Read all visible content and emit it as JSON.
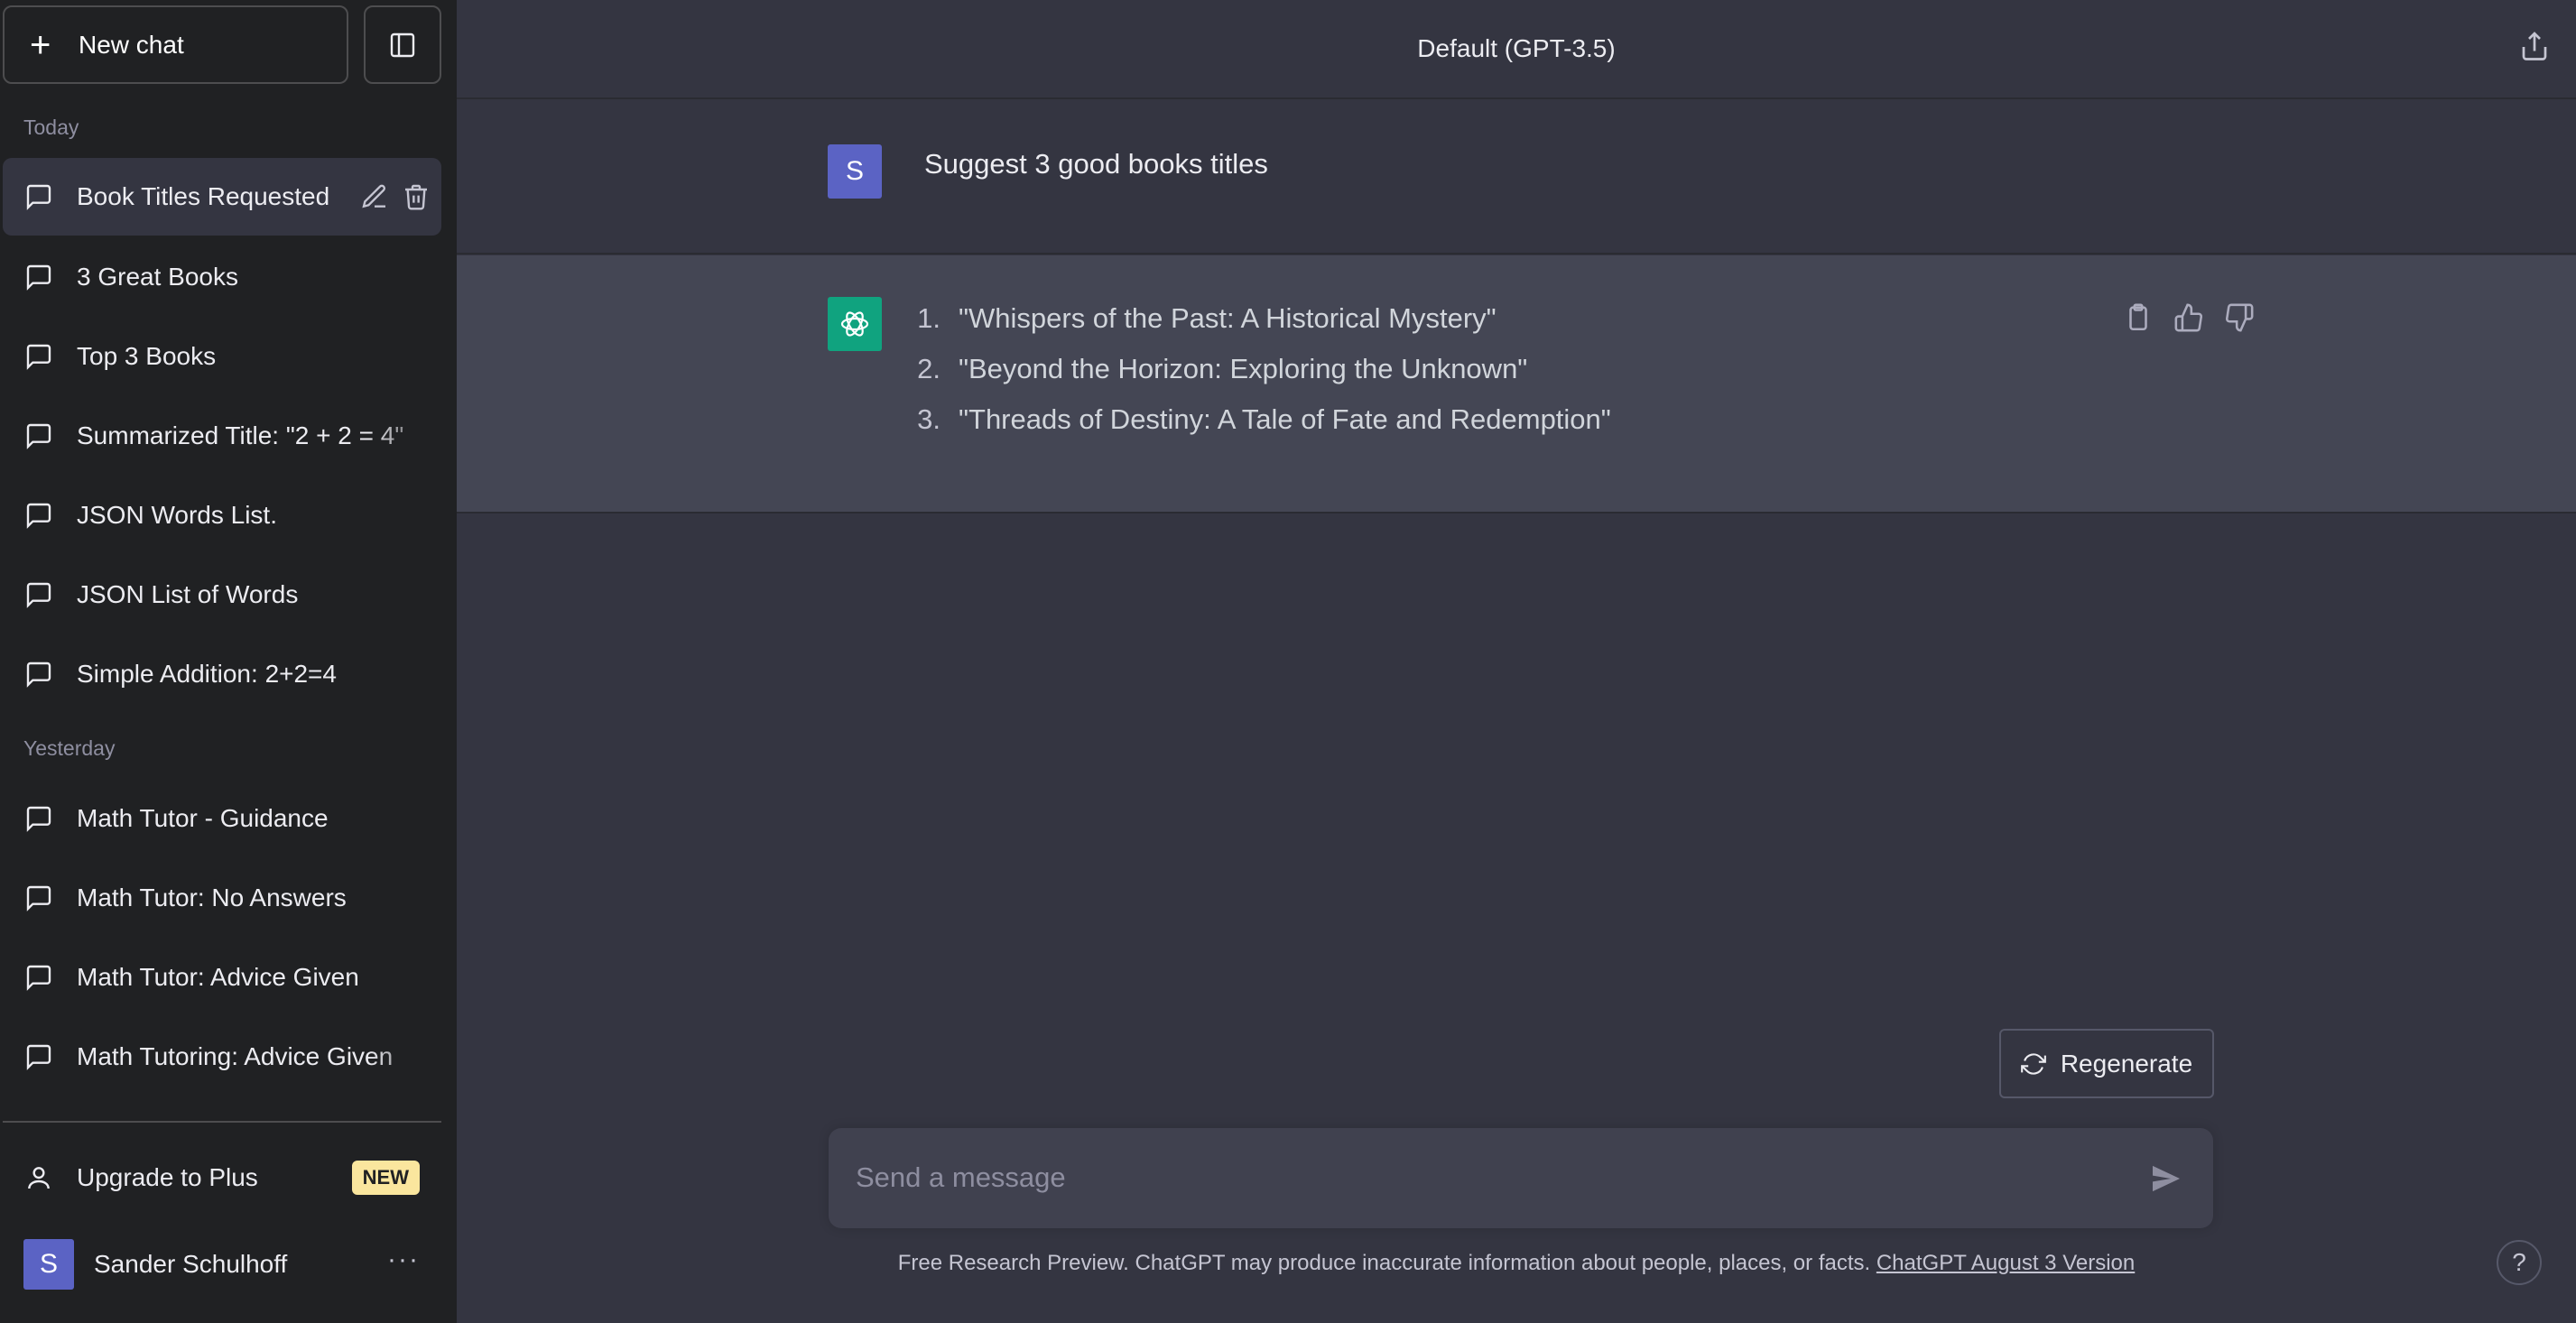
{
  "sidebar": {
    "new_chat_label": "New chat",
    "sections": {
      "today_label": "Today",
      "yesterday_label": "Yesterday"
    },
    "today": [
      {
        "label": "Book Titles Requested"
      },
      {
        "label": "3 Great Books"
      },
      {
        "label": "Top 3 Books"
      },
      {
        "label": "Summarized Title: \"2 + 2 = 4\""
      },
      {
        "label": "JSON Words List."
      },
      {
        "label": "JSON List of Words"
      },
      {
        "label": "Simple Addition: 2+2=4"
      }
    ],
    "yesterday": [
      {
        "label": "Math Tutor - Guidance"
      },
      {
        "label": "Math Tutor: No Answers"
      },
      {
        "label": "Math Tutor: Advice Given"
      },
      {
        "label": "Math Tutoring: Advice Given"
      }
    ],
    "upgrade_label": "Upgrade to Plus",
    "upgrade_badge": "NEW",
    "user_name": "Sander Schulhoff",
    "user_initial": "S"
  },
  "header": {
    "model_title": "Default (GPT-3.5)"
  },
  "conversation": {
    "user_initial": "S",
    "user_message": "Suggest 3 good books titles",
    "assistant_items": [
      {
        "num": "1.",
        "text": "\"Whispers of the Past: A Historical Mystery\""
      },
      {
        "num": "2.",
        "text": "\"Beyond the Horizon: Exploring the Unknown\""
      },
      {
        "num": "3.",
        "text": "\"Threads of Destiny: A Tale of Fate and Redemption\""
      }
    ]
  },
  "composer": {
    "regenerate_label": "Regenerate",
    "placeholder": "Send a message",
    "footer_text": "Free Research Preview. ChatGPT may produce inaccurate information about people, places, or facts.",
    "footer_link": "ChatGPT August 3 Version",
    "help_label": "?"
  },
  "colors": {
    "sidebar_bg": "#202123",
    "main_bg": "#343541",
    "assistant_bg": "#444654",
    "gpt_green": "#10a37f",
    "avatar_purple": "#5b63c4",
    "badge_yellow": "#fae69e"
  }
}
